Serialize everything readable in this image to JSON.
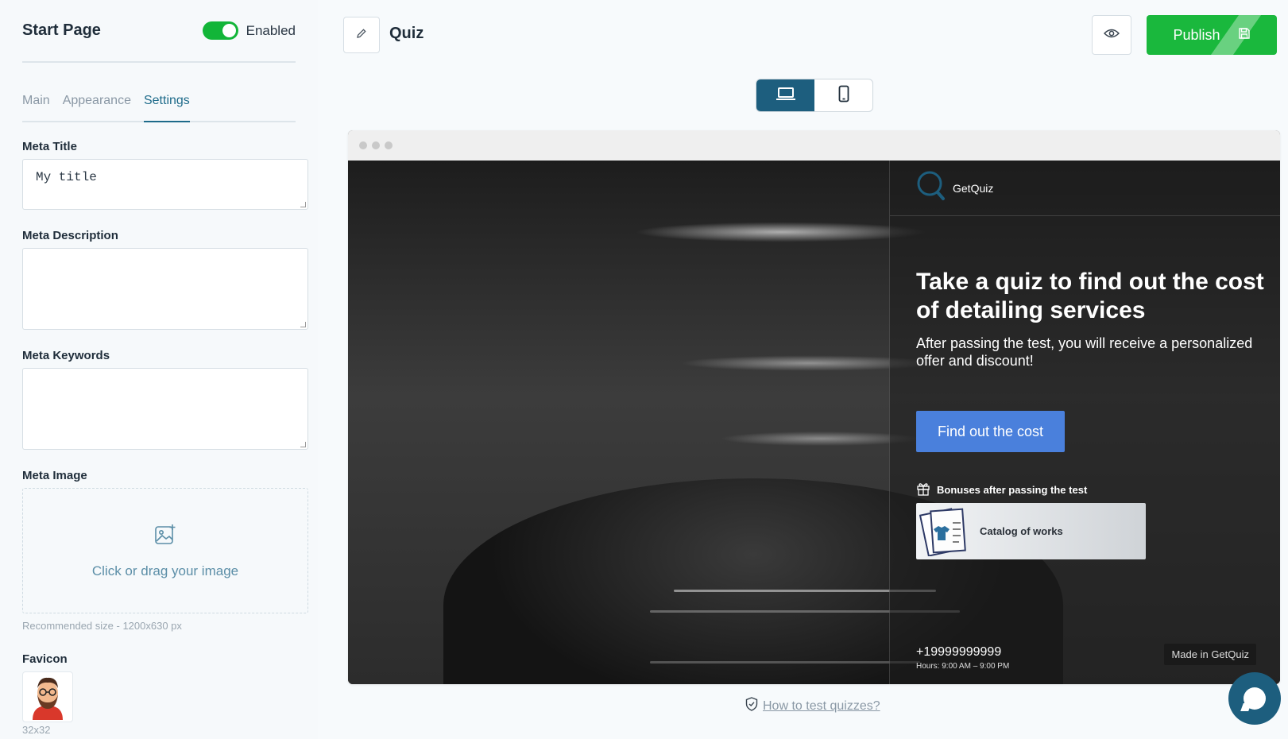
{
  "sidebar": {
    "title": "Start Page",
    "toggle_label": "Enabled",
    "tabs": [
      {
        "label": "Main"
      },
      {
        "label": "Appearance"
      },
      {
        "label": "Settings"
      }
    ],
    "meta_title_label": "Meta Title",
    "meta_title_value": "My title",
    "meta_description_label": "Meta Description",
    "meta_keywords_label": "Meta Keywords",
    "meta_image_label": "Meta Image",
    "dropzone_text": "Click or drag your image",
    "recommended_size": "Recommended size - 1200x630 px",
    "favicon_label": "Favicon",
    "favicon_size": "32x32"
  },
  "topbar": {
    "quiz_title": "Quiz",
    "publish_label": "Publish"
  },
  "preview": {
    "brand": "GetQuiz",
    "title": "Take a quiz to find out the cost of detailing services",
    "subtitle": "After passing the test, you will receive a personalized offer and discount!",
    "cta_label": "Find out the cost",
    "bonuses_label": "Bonuses after passing the test",
    "bonus_item": "Catalog of works",
    "phone": "+19999999999",
    "hours": "Hours: 9:00 AM – 9:00 PM",
    "made_in": "Made in GetQuiz"
  },
  "footer": {
    "howto_link": "How to test quizzes?"
  },
  "colors": {
    "accent": "#1d5e7e",
    "publish": "#1ab83d",
    "toggle_on": "#12b538",
    "cta": "#4a80dc"
  },
  "icons": [
    "pencil-icon",
    "eye-icon",
    "save-icon",
    "laptop-icon",
    "mobile-icon",
    "image-add-icon",
    "search-logo-icon",
    "gift-icon",
    "shield-icon",
    "chat-icon"
  ]
}
